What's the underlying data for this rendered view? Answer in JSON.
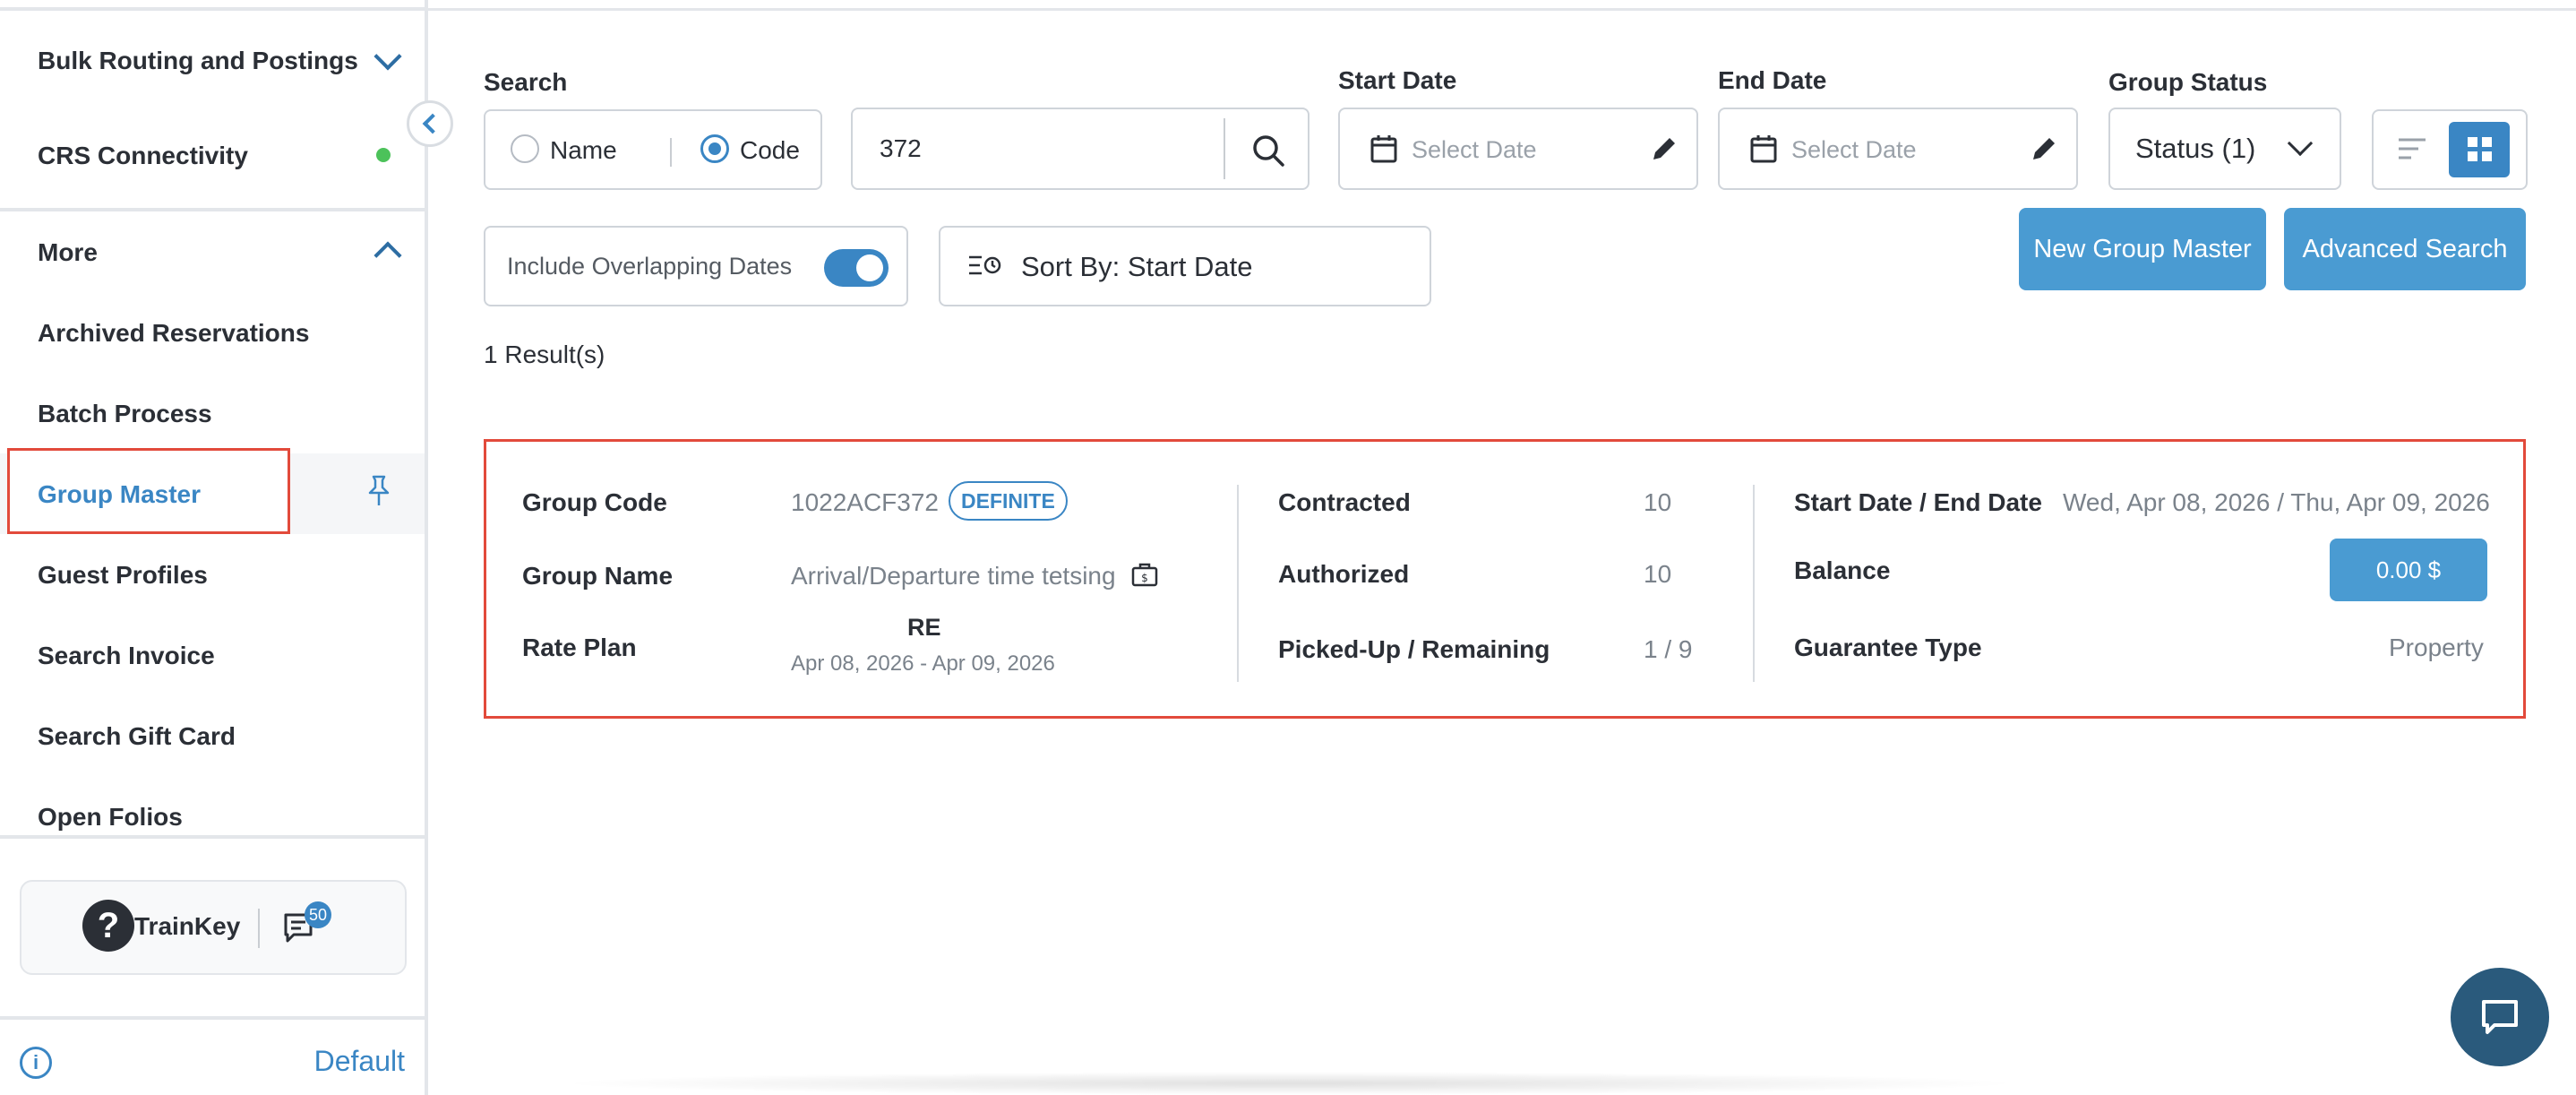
{
  "sidebar": {
    "items": [
      {
        "label": "Bulk Routing and Postings"
      },
      {
        "label": "CRS Connectivity"
      },
      {
        "label": "More"
      },
      {
        "label": "Archived Reservations"
      },
      {
        "label": "Batch Process"
      },
      {
        "label": "Group Master"
      },
      {
        "label": "Guest Profiles"
      },
      {
        "label": "Search Invoice"
      },
      {
        "label": "Search Gift Card"
      },
      {
        "label": "Open Folios"
      }
    ],
    "trainkey_label": "TrainKey",
    "chat_badge": "50",
    "footer_link": "Default",
    "colors": {
      "active_text": "#3a86c4",
      "status_dot": "#4cc25a",
      "highlight_border": "#e24a3b"
    }
  },
  "search": {
    "label": "Search",
    "options": [
      {
        "label": "Name",
        "selected": false
      },
      {
        "label": "Code",
        "selected": true
      }
    ],
    "value": "372"
  },
  "start_date": {
    "label": "Start Date",
    "placeholder": "Select Date"
  },
  "end_date": {
    "label": "End Date",
    "placeholder": "Select Date"
  },
  "group_status": {
    "label": "Group Status",
    "value": "Status (1)"
  },
  "include_overlapping": {
    "label": "Include Overlapping Dates",
    "enabled": true
  },
  "sort": {
    "label": "Sort By: Start Date"
  },
  "buttons": {
    "new_group_master": "New Group Master",
    "advanced_search": "Advanced Search"
  },
  "results": {
    "count_label": "1 Result(s)"
  },
  "result_card": {
    "group_code_label": "Group Code",
    "group_code": "1022ACF372",
    "status_badge": "DEFINITE",
    "group_name_label": "Group Name",
    "group_name": "Arrival/Departure time tetsing",
    "rate_plan_label": "Rate Plan",
    "rate_plan_code": "RE",
    "rate_plan_dates": "Apr 08, 2026 - Apr 09, 2026",
    "contracted_label": "Contracted",
    "contracted": "10",
    "authorized_label": "Authorized",
    "authorized": "10",
    "picked_up_label": "Picked-Up / Remaining",
    "picked_up": "1 / 9",
    "dates_label": "Start Date / End Date",
    "dates": "Wed, Apr 08, 2026 / Thu, Apr 09, 2026",
    "balance_label": "Balance",
    "balance": "0.00 $",
    "guarantee_label": "Guarantee Type",
    "guarantee": "Property"
  },
  "theme": {
    "primary": "#4a9bd2",
    "fab": "#2a5a7c"
  }
}
